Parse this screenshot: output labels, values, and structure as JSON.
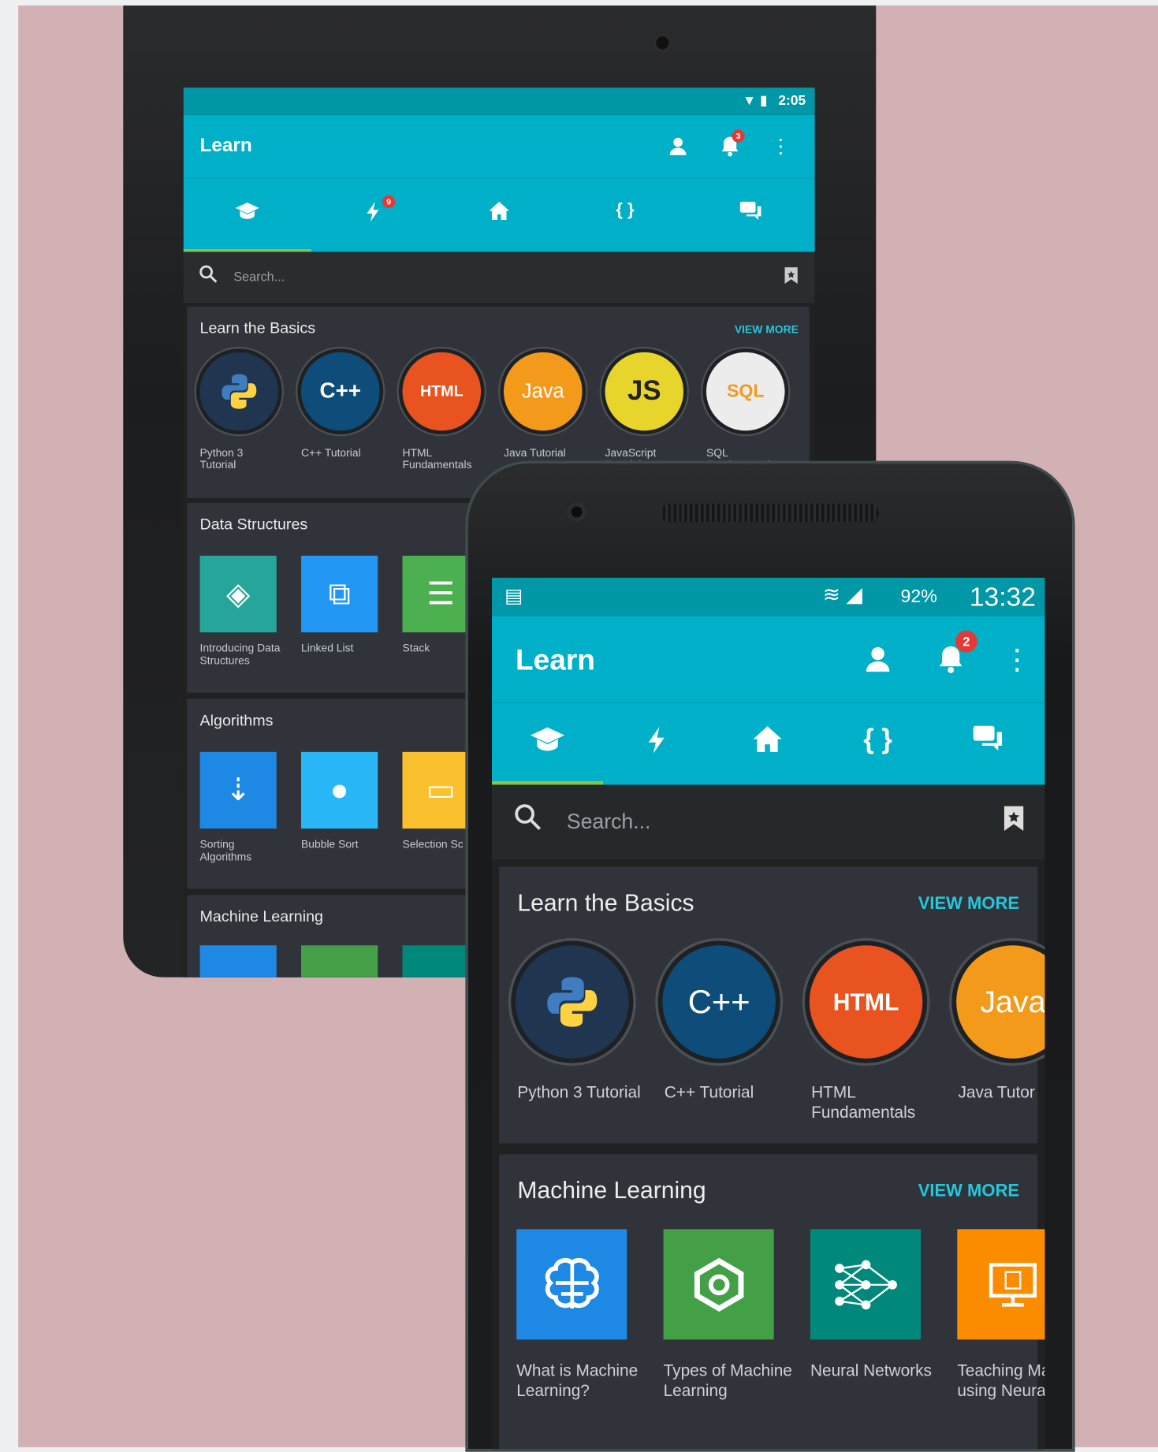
{
  "tablet": {
    "status_time": "2:05",
    "app_title": "Learn",
    "notif_badge": "3",
    "tab_badge": "9",
    "search_placeholder": "Search...",
    "basics": {
      "title": "Learn the Basics",
      "view_more": "VIEW MORE",
      "items": [
        {
          "label": "Python 3 Tutorial",
          "badge": "py",
          "color": "#1f3550"
        },
        {
          "label": "C++ Tutorial",
          "badge": "C++",
          "color": "#0e4d7a"
        },
        {
          "label": "HTML Fundamentals",
          "badge": "HTML",
          "color": "#e8531f"
        },
        {
          "label": "Java Tutorial",
          "badge": "Java",
          "color": "#f39a1b"
        },
        {
          "label": "JavaScript Tutorial",
          "badge": "JS",
          "color": "#e8d52b"
        },
        {
          "label": "SQL Fundamentals",
          "badge": "SQL",
          "color": "#e9e9e9"
        }
      ]
    },
    "data_structures": {
      "title": "Data Structures",
      "items": [
        {
          "label": "Introducing Data Structures",
          "color": "#26a69a"
        },
        {
          "label": "Linked List",
          "color": "#2196f3"
        },
        {
          "label": "Stack",
          "color": "#4caf50"
        }
      ]
    },
    "algorithms": {
      "title": "Algorithms",
      "items": [
        {
          "label": "Sorting Algorithms",
          "color": "#1e88e5"
        },
        {
          "label": "Bubble Sort",
          "color": "#29b6f6"
        },
        {
          "label": "Selection Sc",
          "color": "#fbc02d"
        }
      ]
    },
    "ml": {
      "title": "Machine Learning"
    }
  },
  "phone": {
    "status_battery": "92%",
    "status_time": "13:32",
    "app_title": "Learn",
    "notif_badge": "2",
    "search_placeholder": "Search...",
    "basics": {
      "title": "Learn the Basics",
      "view_more": "VIEW MORE",
      "items": [
        {
          "label": "Python 3 Tutorial",
          "color": "#1f3550"
        },
        {
          "label": "C++ Tutorial",
          "badge": "C++",
          "color": "#0e4d7a"
        },
        {
          "label": "HTML Fundamentals",
          "badge": "HTML",
          "color": "#e8531f"
        },
        {
          "label": "Java Tutor",
          "badge": "Java",
          "color": "#f39a1b"
        }
      ]
    },
    "ml": {
      "title": "Machine Learning",
      "view_more": "VIEW MORE",
      "items": [
        {
          "label": "What is Machine Learning?",
          "color": "#1e88e5"
        },
        {
          "label": "Types of Machine Learning",
          "color": "#43a047"
        },
        {
          "label": "Neural Networks",
          "color": "#00897b"
        },
        {
          "label": "Teaching Math using Neural...",
          "color": "#fb8c00"
        }
      ]
    }
  }
}
